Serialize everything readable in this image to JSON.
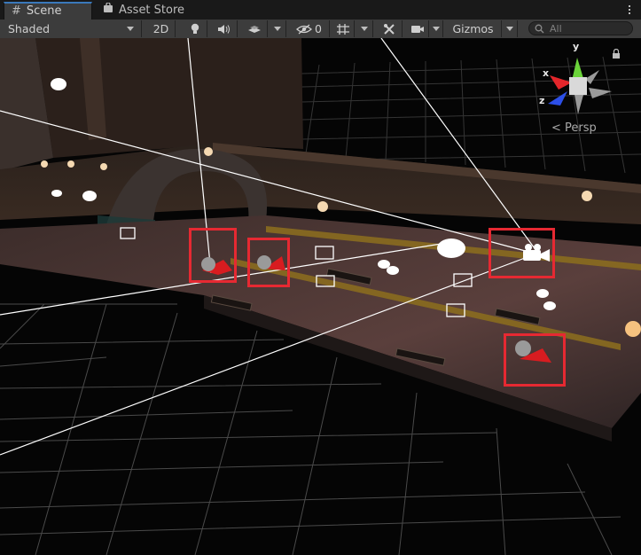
{
  "tabs": [
    {
      "label": "Scene",
      "icon": "hash-icon",
      "active": true
    },
    {
      "label": "Asset Store",
      "icon": "store-bag-icon",
      "active": false
    }
  ],
  "toolbar": {
    "draw_mode": "Shaded",
    "mode_2d": "2D",
    "hidden_count": "0",
    "gizmos_label": "Gizmos",
    "search_placeholder": "All"
  },
  "orientation_gizmo": {
    "x_label": "x",
    "y_label": "y",
    "z_label": "z",
    "projection_label": "< Persp"
  },
  "colors": {
    "selection_highlight": "#e62932",
    "axis_x": "#e3262b",
    "axis_y": "#6bd43a",
    "axis_z": "#2c4fe8",
    "tab_accent": "#3a79bb"
  }
}
